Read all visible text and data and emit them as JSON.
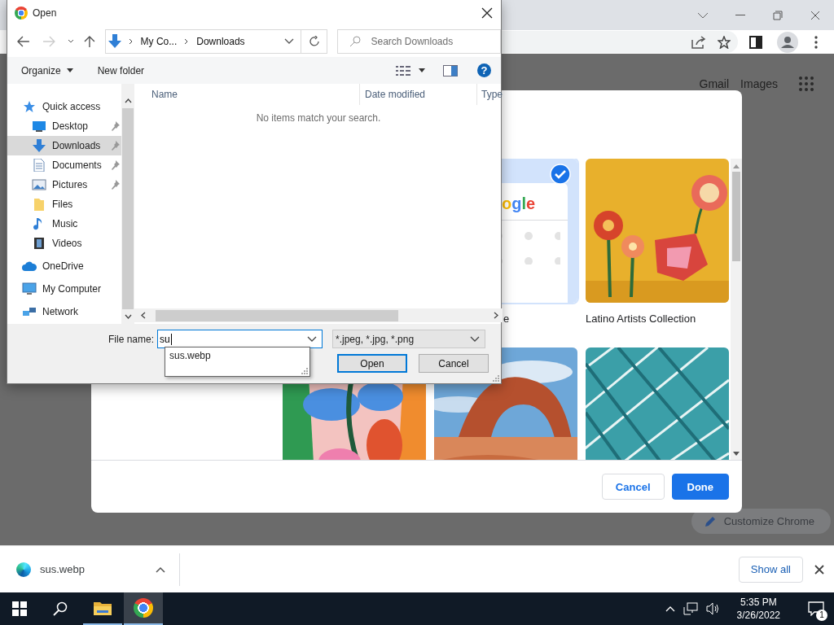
{
  "page": {
    "links": [
      "Gmail",
      "Images"
    ],
    "customize_button": "Customize Chrome"
  },
  "background_dialog": {
    "tiles": [
      {
        "kind": "logo",
        "logo_text": "ogle",
        "label": "e",
        "selected": true
      },
      {
        "kind": "picture",
        "label": "Latino Artists Collection",
        "selected": false
      },
      {
        "kind": "picture",
        "selected": false
      },
      {
        "kind": "picture",
        "selected": false
      },
      {
        "kind": "picture",
        "selected": false
      }
    ],
    "buttons": [
      {
        "label": "Cancel",
        "kind": "secondary"
      },
      {
        "label": "Done",
        "kind": "primary"
      }
    ]
  },
  "open_dialog": {
    "title": "Open",
    "path": [
      "My Co...",
      "Downloads"
    ],
    "search_placeholder": "Search Downloads",
    "toolbar": [
      {
        "label": "Organize",
        "menu": true
      },
      {
        "label": "New folder",
        "menu": false
      }
    ],
    "help": "?",
    "sidebar": [
      {
        "label": "Quick access",
        "kind": "star",
        "selected": false,
        "children": [
          {
            "label": "Desktop",
            "kind": "desktop",
            "pinned": true,
            "selected": false
          },
          {
            "label": "Downloads",
            "kind": "download",
            "pinned": true,
            "selected": true
          },
          {
            "label": "Documents",
            "kind": "document",
            "pinned": true,
            "selected": false
          },
          {
            "label": "Pictures",
            "kind": "pictures",
            "pinned": true,
            "selected": false
          },
          {
            "label": "Files",
            "kind": "folder",
            "pinned": false,
            "selected": false
          },
          {
            "label": "Music",
            "kind": "music",
            "pinned": false,
            "selected": false
          },
          {
            "label": "Videos",
            "kind": "video",
            "pinned": false,
            "selected": false
          }
        ]
      },
      {
        "label": "OneDrive",
        "kind": "cloud",
        "selected": false
      },
      {
        "label": "My Computer",
        "kind": "computer",
        "selected": false
      },
      {
        "label": "Network",
        "kind": "network",
        "selected": false
      }
    ],
    "columns": [
      "Name",
      "Date modified",
      "Type"
    ],
    "empty_message": "No items match your search.",
    "file_name_label": "File name:",
    "file_name": "su",
    "suggestions": [
      "sus.webp"
    ],
    "file_type": "*.jpeg, *.jpg, *.png",
    "buttons": [
      {
        "label": "Open",
        "kind": "default"
      },
      {
        "label": "Cancel",
        "kind": "normal"
      }
    ]
  },
  "download_bar": {
    "file": "sus.webp",
    "show_all": "Show all"
  },
  "taskbar": {
    "apps": [
      {
        "kind": "explorer",
        "running": true,
        "selected": false
      },
      {
        "kind": "chrome",
        "running": true,
        "selected": true
      }
    ],
    "time": "5:35 PM",
    "date": "3/26/2022",
    "notifications": "1"
  }
}
